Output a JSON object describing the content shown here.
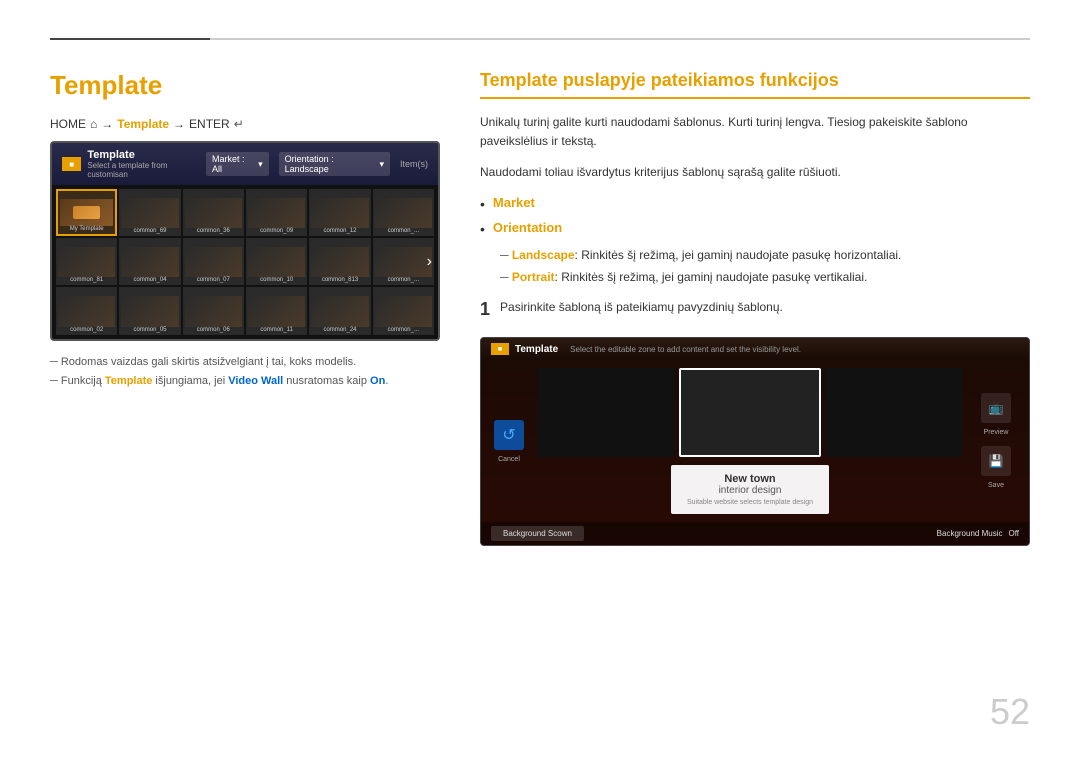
{
  "topLine": {
    "darkWidth": "160px",
    "lightFlex": "1"
  },
  "leftColumn": {
    "sectionTitle": "Template",
    "breadcrumb": {
      "home": "HOME",
      "homeIcon": "⌂",
      "arrow": "→",
      "template": "Template",
      "arrow2": "→",
      "enter": "ENTER",
      "enterIcon": "↵"
    },
    "tvScreen": {
      "logoText": "■",
      "title": "Template",
      "subtitle": "Select a template from customisan",
      "dropdownMarket": "Market : All",
      "dropdownOrientation": "Orientation : Landscape",
      "itemsLabel": "Item(s)",
      "gridItems": [
        {
          "label": "My Template",
          "selected": true
        },
        {
          "label": "common_69"
        },
        {
          "label": "common_36"
        },
        {
          "label": "common_09"
        },
        {
          "label": "common_12"
        },
        {
          "label": "common_..."
        },
        {
          "label": "common_81"
        },
        {
          "label": "common_04"
        },
        {
          "label": "common_07"
        },
        {
          "label": "common_10"
        },
        {
          "label": "common_813"
        },
        {
          "label": "common_..."
        },
        {
          "label": "common_02"
        },
        {
          "label": "common_05"
        },
        {
          "label": "common_06"
        },
        {
          "label": "common_11"
        },
        {
          "label": "common_24"
        },
        {
          "label": "common_..."
        }
      ]
    },
    "notes": [
      "Rodomas vaizdas gali skirtis atsižvelgiant į tai, koks modelis.",
      "Funkciją {template} išjungiama, jei {videowall} nusratomas kaip {on}."
    ],
    "noteHighlights": {
      "template": "Template",
      "videowall": "Video Wall",
      "on": "On"
    }
  },
  "rightColumn": {
    "sectionTitle": "Template puslapyje pateikiamos funkcijos",
    "description1": "Unikalų turinį galite kurti naudodami šablonus. Kurti turinį lengva. Tiesiog pakeiskite šablono paveikslėlius ir tekstą.",
    "description2": "Naudodami toliau išvardytus kriterijus šablonų sąrašą galite rūšiuoti.",
    "bullets": [
      {
        "label": "Market",
        "subItems": []
      },
      {
        "label": "Orientation",
        "subItems": [
          {
            "highlight": "Landscape",
            "text": ": Rinkitės šį režimą, jei gaminį naudojate pasukę horizontaliai."
          },
          {
            "highlight": "Portrait",
            "text": ": Rinkitės šį režimą, jei gaminį naudojate pasukę vertikaliai."
          }
        ]
      }
    ],
    "step": {
      "number": "1",
      "text": "Pasirinkite šabloną iš pateikiamų pavyzdinių šablonų."
    },
    "previewScreen": {
      "logoText": "■",
      "title": "Template",
      "subtitle": "Select the editable zone to add content and set the visibility level.",
      "cancelLabel": "Cancel",
      "previewLabel": "Preview",
      "saveLabel": "Save",
      "textMain": "New town",
      "textSub": "interior design",
      "textNote": "Suitable website selects template design",
      "footerLeft": "Background Scown",
      "footerRight": "Background Music",
      "footerRightValue": "Off"
    }
  },
  "pageNumber": "52"
}
